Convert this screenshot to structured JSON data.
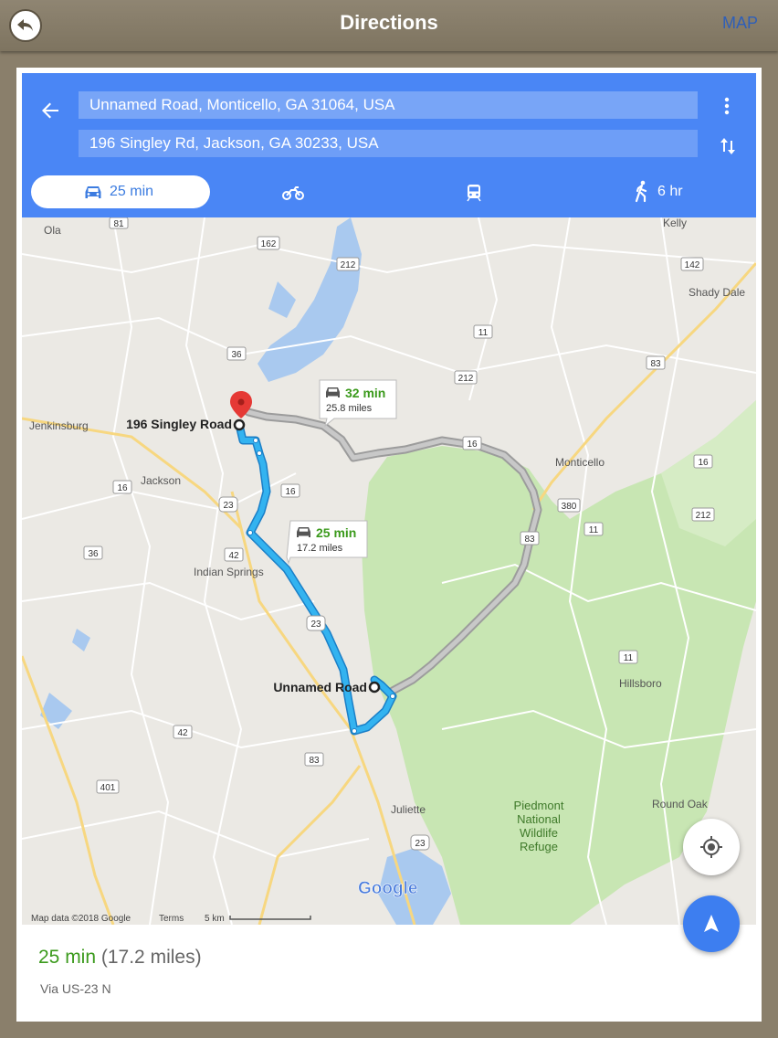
{
  "app": {
    "title": "Directions",
    "map_link": "MAP"
  },
  "route": {
    "origin": "Unnamed Road, Monticello, GA 31064, USA",
    "destination": "196 Singley Rd, Jackson, GA 30233, USA"
  },
  "modes": {
    "car": "25 min",
    "walk": "6 hr"
  },
  "map": {
    "pins": {
      "dest": "196 Singley Road",
      "origin": "Unnamed Road"
    },
    "callout_alt": {
      "time": "32 min",
      "dist": "25.8 miles"
    },
    "callout_main": {
      "time": "25 min",
      "dist": "17.2 miles"
    },
    "places": {
      "ola": "Ola",
      "kelly": "Kelly",
      "shady_dale": "Shady Dale",
      "jenkinsburg": "Jenkinsburg",
      "jackson": "Jackson",
      "monticello": "Monticello",
      "indian_springs": "Indian Springs",
      "hillsboro": "Hillsboro",
      "juliette": "Juliette",
      "round_oak": "Round Oak",
      "piedmont": "Piedmont",
      "national": "National",
      "wildlife": "Wildlife",
      "refuge": "Refuge"
    },
    "shields": {
      "s81": "81",
      "s162": "162",
      "s212a": "212",
      "s142": "142",
      "s11a": "11",
      "s36a": "36",
      "s212b": "212",
      "s83a": "83",
      "s16a": "16",
      "s16b": "16",
      "s16c": "16",
      "s16d": "16",
      "s23a": "23",
      "s380": "380",
      "s11b": "11",
      "s212c": "212",
      "s36b": "36",
      "s42a": "42",
      "s83b": "83",
      "s23b": "23",
      "s11c": "11",
      "s42b": "42",
      "s401": "401",
      "s83c": "83",
      "s23c": "23"
    },
    "attribution": "Map data ©2018 Google",
    "terms": "Terms",
    "scale": "5 km",
    "logo": "Google"
  },
  "summary": {
    "time": "25 min",
    "distance": "(17.2 miles)",
    "via": "Via US-23 N"
  },
  "colors": {
    "accent": "#4a86f5",
    "route": "#2ea8e8",
    "route_alt": "#a8a8a8",
    "green_time": "#3b9a1c"
  }
}
